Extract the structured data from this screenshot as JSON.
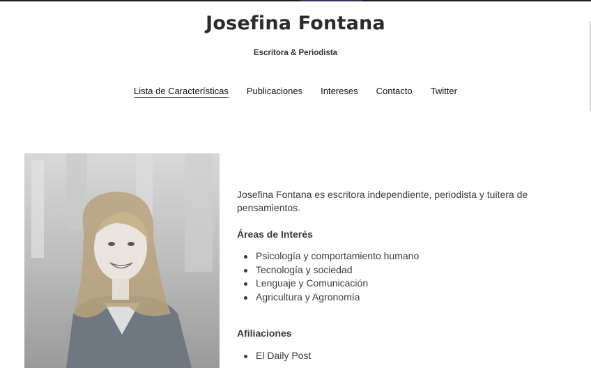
{
  "site": {
    "title": "Josefina Fontana",
    "subtitle": "Escritora & Periodista"
  },
  "nav": {
    "items": [
      {
        "label": "Lista de Características",
        "active": true
      },
      {
        "label": "Publicaciones",
        "active": false
      },
      {
        "label": "Intereses",
        "active": false
      },
      {
        "label": "Contacto",
        "active": false
      },
      {
        "label": "Twitter",
        "active": false
      }
    ]
  },
  "profile": {
    "photo_alt": "Josefina Fontana",
    "intro": "Josefina Fontana es escritora independiente, periodista y tuitera de pensamientos.",
    "interests_heading": "Áreas de Interés",
    "interests": [
      "Psicología y comportamiento humano",
      "Tecnología y sociedad",
      "Lenguaje y Comunicación",
      "Agricultura y Agronomía"
    ],
    "affiliations_heading": "Afiliaciones",
    "affiliations": [
      "El Daily Post"
    ]
  },
  "colors": {
    "text": "#3c3c3c",
    "title": "#2b2b2b",
    "background": "#ffffff"
  }
}
